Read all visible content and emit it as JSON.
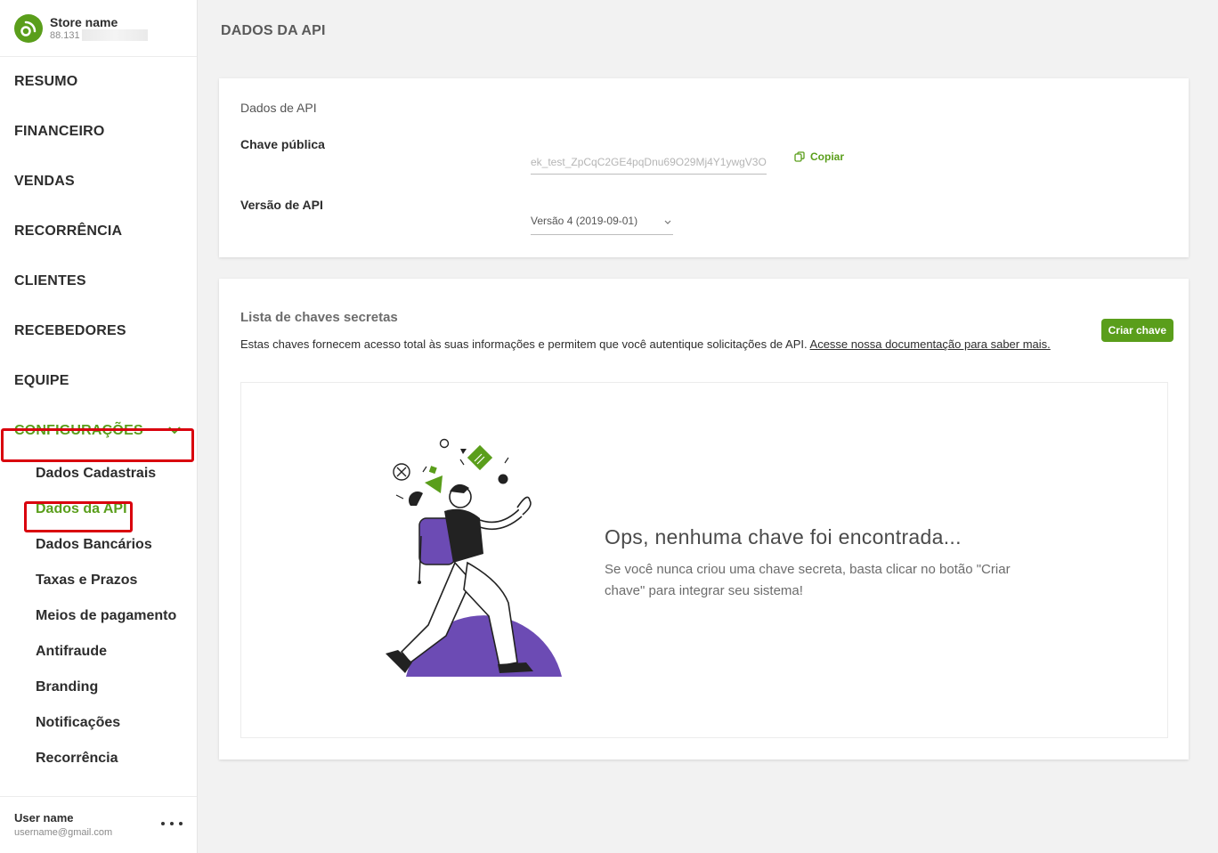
{
  "store": {
    "name": "Store name",
    "id": "88.131"
  },
  "nav": {
    "items": [
      "RESUMO",
      "FINANCEIRO",
      "VENDAS",
      "RECORRÊNCIA",
      "CLIENTES",
      "RECEBEDORES",
      "EQUIPE"
    ],
    "active_group": "CONFIGURAÇÕES",
    "sub_items": [
      "Dados Cadastrais",
      "Dados da API",
      "Dados Bancários",
      "Taxas e Prazos",
      "Meios de pagamento",
      "Antifraude",
      "Branding",
      "Notificações",
      "Recorrência"
    ],
    "active_sub": "Dados da API"
  },
  "user": {
    "name": "User name",
    "email": "username@gmail.com"
  },
  "page": {
    "title": "DADOS DA API"
  },
  "api_card": {
    "section_label": "Dados de API",
    "public_key_label": "Chave pública",
    "public_key_value": "ek_test_ZpCqC2GE4pqDnu69O29Mj4Y1ywgV3O",
    "copy_label": "Copiar",
    "version_label": "Versão de API",
    "version_value": "Versão 4 (2019-09-01)"
  },
  "secret_keys": {
    "title": "Lista de chaves secretas",
    "description": "Estas chaves fornecem acesso total às suas informações e permitem que você autentique solicitações de API.",
    "doc_link": "Acesse nossa documentação para saber mais.",
    "create_button": "Criar chave",
    "empty_title": "Ops, nenhuma chave foi encontrada...",
    "empty_text": "Se você nunca criou uma chave secreta, basta clicar no botão \"Criar chave\" para integrar seu sistema!"
  },
  "colors": {
    "accent": "#5a9e1b",
    "highlight": "#d9000d",
    "illustration_purple": "#6c4bb4"
  }
}
